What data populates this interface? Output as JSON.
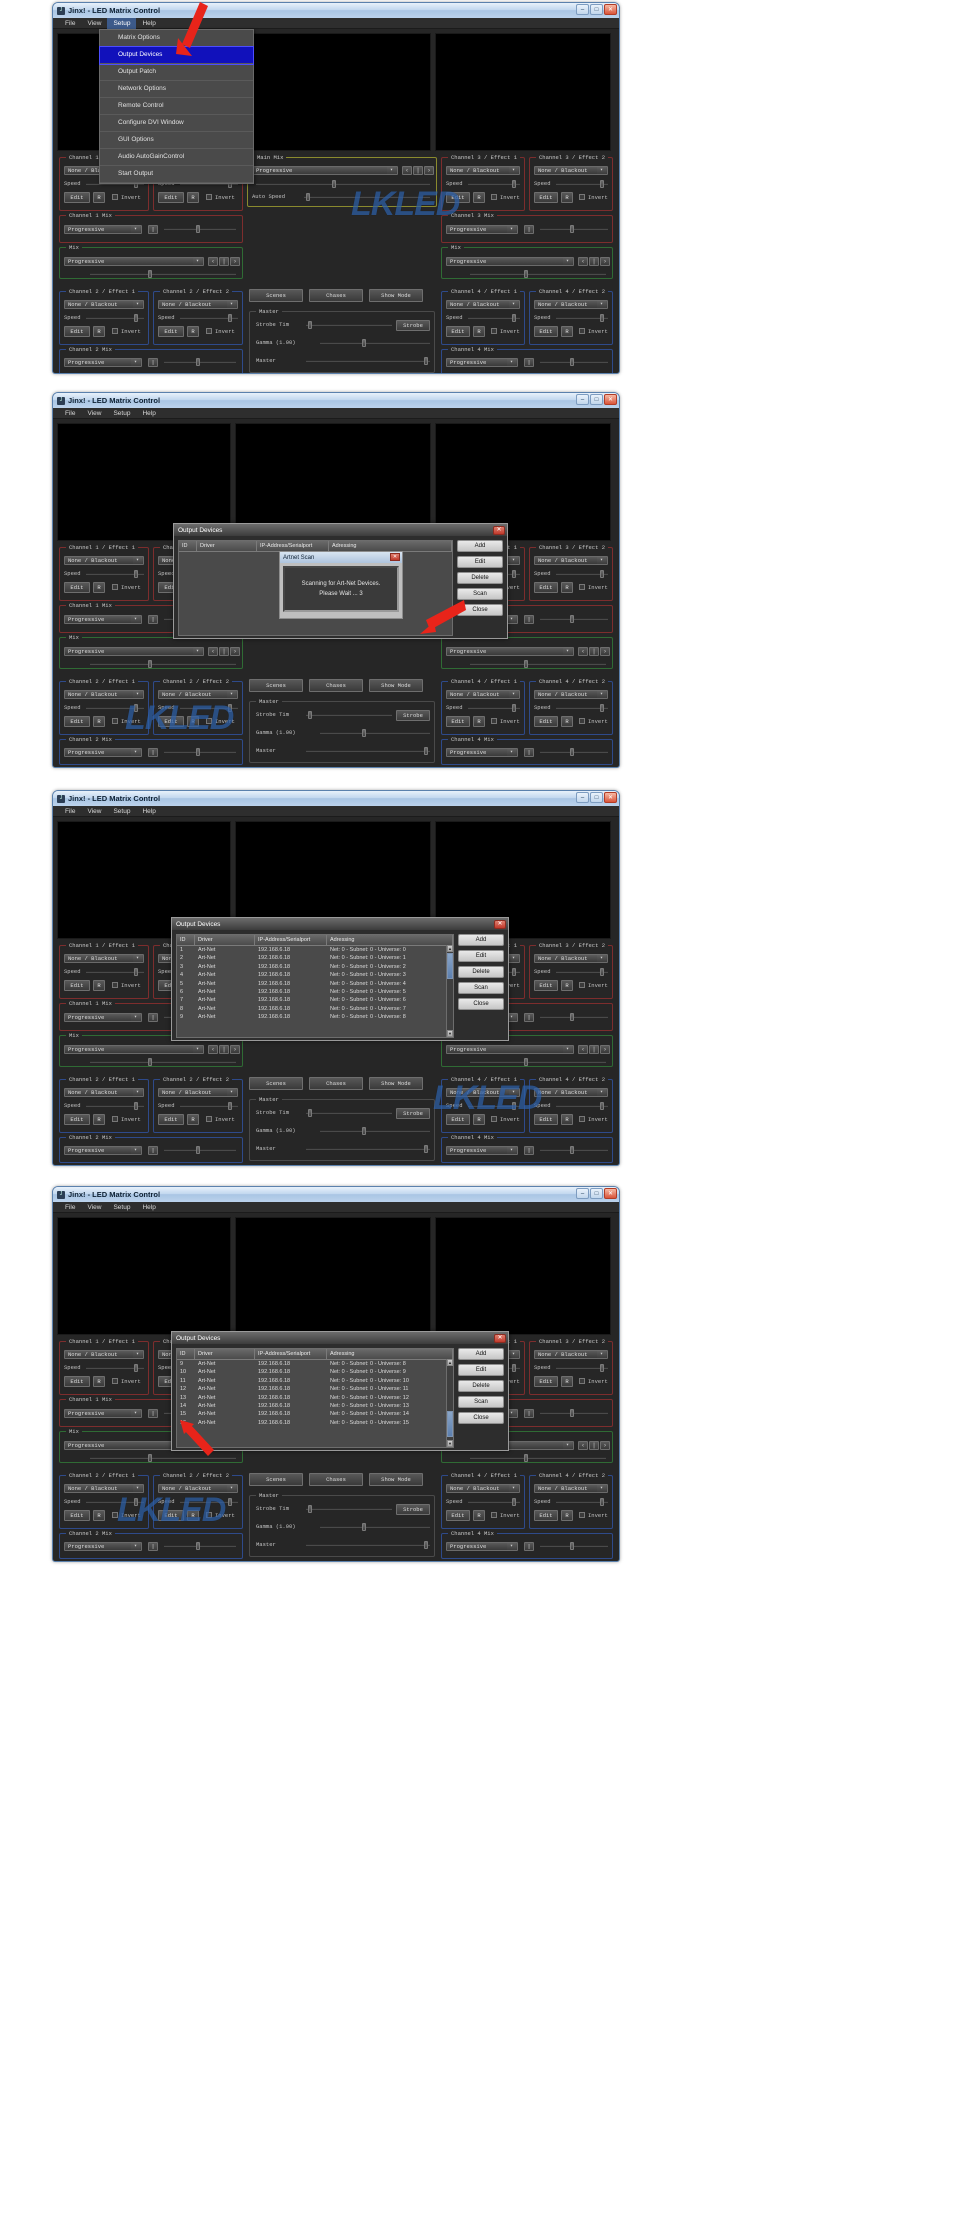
{
  "app": {
    "title": "Jinx! - LED Matrix Control",
    "window_buttons": {
      "minimize": "–",
      "maximize": "□",
      "close": "✕"
    },
    "menubar": [
      "File",
      "View",
      "Setup",
      "Help"
    ]
  },
  "setup_menu": {
    "items": [
      "Matrix Options",
      "Output Devices",
      "Output Patch",
      "Network Options",
      "Remote Control",
      "Configure DVI Window",
      "GUI Options",
      "Audio AutoGainControl",
      "Start Output"
    ],
    "selected": "Output Devices"
  },
  "panels": {
    "channel1_effect1": {
      "caption": "Channel 1 / Effect 1",
      "effect": "None / Blackout",
      "speed_label": "Speed",
      "edit": "Edit",
      "r": "R",
      "invert": "Invert"
    },
    "channel1_effect2": {
      "caption": "Channel 1 / Effect 2",
      "effect": "None / Blackout",
      "speed_label": "Speed",
      "edit": "Edit",
      "r": "R",
      "invert": "Invert"
    },
    "channel1_mix": {
      "caption": "Channel 1 Mix",
      "mode": "Progressive"
    },
    "channel2_effect1": {
      "caption": "Channel 2 / Effect 1",
      "effect": "None / Blackout",
      "speed_label": "Speed",
      "edit": "Edit",
      "r": "R",
      "invert": "Invert"
    },
    "channel2_effect2": {
      "caption": "Channel 2 / Effect 2",
      "effect": "None / Blackout",
      "speed_label": "Speed",
      "edit": "Edit",
      "r": "R",
      "invert": "Invert"
    },
    "channel2_mix": {
      "caption": "Channel 2 Mix",
      "mode": "Progressive"
    },
    "channel3_effect1": {
      "caption": "Channel 3 / Effect 1",
      "effect": "None / Blackout",
      "speed_label": "Speed",
      "edit": "Edit",
      "r": "R",
      "invert": "Invert"
    },
    "channel3_effect2": {
      "caption": "Channel 3 / Effect 2",
      "effect": "None / Blackout",
      "speed_label": "Speed",
      "edit": "Edit",
      "r": "R",
      "invert": "Invert"
    },
    "channel3_mix": {
      "caption": "Channel 3 Mix",
      "mode": "Progressive"
    },
    "channel4_effect1": {
      "caption": "Channel 4 / Effect 1",
      "effect": "None / Blackout",
      "speed_label": "Speed",
      "edit": "Edit",
      "r": "R",
      "invert": "Invert"
    },
    "channel4_effect2": {
      "caption": "Channel 4 / Effect 2",
      "effect": "None / Blackout",
      "speed_label": "Speed",
      "edit": "Edit",
      "r": "R",
      "invert": "Invert"
    },
    "channel4_mix": {
      "caption": "Channel 4 Mix",
      "mode": "Progressive"
    },
    "mix_left": {
      "caption": "Mix",
      "mode": "Progressive"
    },
    "mix_right": {
      "caption": "Mix",
      "mode": "Progressive"
    },
    "main_mix": {
      "caption": "Main Mix",
      "mode": "Progressive",
      "auto_speed_label": "Auto Speed"
    },
    "center": {
      "scenes": "Scenes",
      "chases": "Chases",
      "show_mode": "Show Mode",
      "master_caption": "Master",
      "strobe_label": "Strobe Tim",
      "strobe_button": "Strobe",
      "gamma_label": "Gamma (1.00)",
      "master_label": "Master"
    }
  },
  "output_devices_dialog": {
    "title": "Output Devices",
    "close": "✕",
    "columns": [
      "ID",
      "Driver",
      "IP-Address/Serialport",
      "Adressing"
    ],
    "buttons": [
      "Add",
      "Edit",
      "Delete",
      "Scan",
      "Close"
    ],
    "rows_page1": [
      {
        "id": "1",
        "driver": "Art-Net",
        "ip": "192.168.6.18",
        "adressing": "Net: 0 - Subnet: 0 - Universe: 0"
      },
      {
        "id": "2",
        "driver": "Art-Net",
        "ip": "192.168.6.18",
        "adressing": "Net: 0 - Subnet: 0 - Universe: 1"
      },
      {
        "id": "3",
        "driver": "Art-Net",
        "ip": "192.168.6.18",
        "adressing": "Net: 0 - Subnet: 0 - Universe: 2"
      },
      {
        "id": "4",
        "driver": "Art-Net",
        "ip": "192.168.6.18",
        "adressing": "Net: 0 - Subnet: 0 - Universe: 3"
      },
      {
        "id": "5",
        "driver": "Art-Net",
        "ip": "192.168.6.18",
        "adressing": "Net: 0 - Subnet: 0 - Universe: 4"
      },
      {
        "id": "6",
        "driver": "Art-Net",
        "ip": "192.168.6.18",
        "adressing": "Net: 0 - Subnet: 0 - Universe: 5"
      },
      {
        "id": "7",
        "driver": "Art-Net",
        "ip": "192.168.6.18",
        "adressing": "Net: 0 - Subnet: 0 - Universe: 6"
      },
      {
        "id": "8",
        "driver": "Art-Net",
        "ip": "192.168.6.18",
        "adressing": "Net: 0 - Subnet: 0 - Universe: 7"
      },
      {
        "id": "9",
        "driver": "Art-Net",
        "ip": "192.168.6.18",
        "adressing": "Net: 0 - Subnet: 0 - Universe: 8"
      }
    ],
    "rows_page2": [
      {
        "id": "9",
        "driver": "Art-Net",
        "ip": "192.168.6.18",
        "adressing": "Net: 0 - Subnet: 0 - Universe: 8"
      },
      {
        "id": "10",
        "driver": "Art-Net",
        "ip": "192.168.6.18",
        "adressing": "Net: 0 - Subnet: 0 - Universe: 9"
      },
      {
        "id": "11",
        "driver": "Art-Net",
        "ip": "192.168.6.18",
        "adressing": "Net: 0 - Subnet: 0 - Universe: 10"
      },
      {
        "id": "12",
        "driver": "Art-Net",
        "ip": "192.168.6.18",
        "adressing": "Net: 0 - Subnet: 0 - Universe: 11"
      },
      {
        "id": "13",
        "driver": "Art-Net",
        "ip": "192.168.6.18",
        "adressing": "Net: 0 - Subnet: 0 - Universe: 12"
      },
      {
        "id": "14",
        "driver": "Art-Net",
        "ip": "192.168.6.18",
        "adressing": "Net: 0 - Subnet: 0 - Universe: 13"
      },
      {
        "id": "15",
        "driver": "Art-Net",
        "ip": "192.168.6.18",
        "adressing": "Net: 0 - Subnet: 0 - Universe: 14"
      },
      {
        "id": "16",
        "driver": "Art-Net",
        "ip": "192.168.6.18",
        "adressing": "Net: 0 - Subnet: 0 - Universe: 15"
      }
    ]
  },
  "artnet_scan": {
    "title": "Artnet Scan",
    "close": "✕",
    "line1": "Scanning for Art-Net Devices.",
    "line2": "Please Wait ... 3"
  },
  "watermark": {
    "text": "LKLED"
  },
  "colors": {
    "selection_blue": "#1111bb",
    "arrow_red": "#e8241a",
    "watermark_blue": "#2c5fa8",
    "group_red": "#7d2d2d",
    "group_green": "#2f6b34",
    "group_blue": "#2e4a8a",
    "group_yellow": "#8a8a2e"
  }
}
